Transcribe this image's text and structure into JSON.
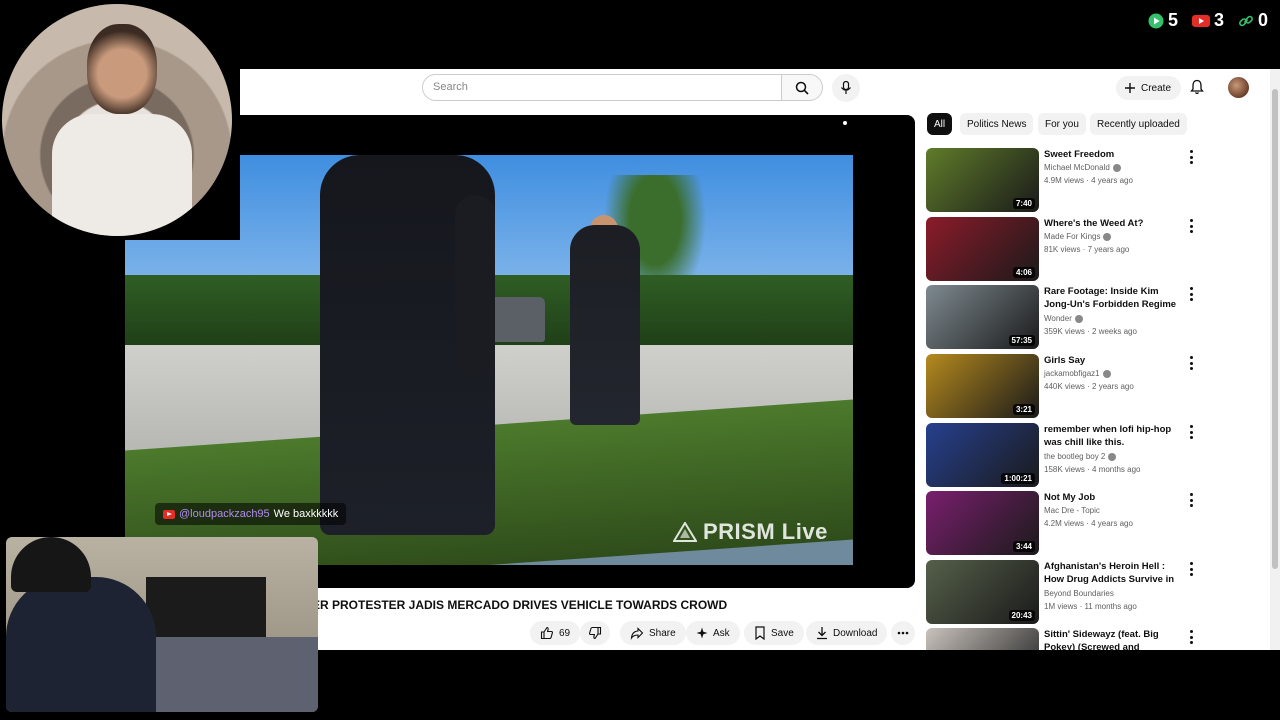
{
  "stream_stats": [
    {
      "icon": "play-triangle-icon",
      "value": "5",
      "color": "#35c16b"
    },
    {
      "icon": "youtube-icon",
      "value": "3",
      "color": "#e52d27"
    },
    {
      "icon": "link-icon",
      "value": "0",
      "color": "#35c16b"
    }
  ],
  "topbar": {
    "search_placeholder": "Search",
    "create_label": "Create"
  },
  "player": {
    "chat_user": "@loudpackzach95",
    "chat_message": "We baxkkkkk",
    "watermark": "PRISM Live"
  },
  "video": {
    "title": "ER PROTESTER JADIS MERCADO DRIVES VEHICLE TOWARDS CROWD",
    "likes": "69",
    "share_label": "Share",
    "ask_label": "Ask",
    "save_label": "Save",
    "download_label": "Download"
  },
  "chips": [
    "All",
    "Politics News",
    "For you",
    "Recently uploaded"
  ],
  "recommendations": [
    {
      "title": "Sweet Freedom",
      "channel": "Michael McDonald",
      "verified": true,
      "meta": "4.9M views · 4 years ago",
      "duration": "7:40",
      "music": true,
      "thumb_color": "#5f7c2a"
    },
    {
      "title": "Where's the Weed At?",
      "channel": "Made For Kings",
      "verified": true,
      "meta": "81K views · 7 years ago",
      "duration": "4:06",
      "music": true,
      "thumb_color": "#8c1b2a"
    },
    {
      "title": "Rare Footage: Inside Kim Jong-Un's Forbidden Regime",
      "channel": "Wonder",
      "verified": true,
      "meta": "359K views · 2 weeks ago",
      "duration": "57:35",
      "music": false,
      "thumb_color": "#7e8a90"
    },
    {
      "title": "Girls Say",
      "channel": "jackamobfigaz1",
      "verified": true,
      "meta": "440K views · 2 years ago",
      "duration": "3:21",
      "music": true,
      "thumb_color": "#b58a1e"
    },
    {
      "title": "remember when lofi hip-hop was chill like this.",
      "channel": "the bootleg boy 2",
      "verified": true,
      "meta": "158K views · 4 months ago",
      "duration": "1:00:21",
      "music": true,
      "thumb_color": "#26408f"
    },
    {
      "title": "Not My Job",
      "channel": "Mac Dre - Topic",
      "verified": false,
      "meta": "4.2M views · 4 years ago",
      "duration": "3:44",
      "music": true,
      "thumb_color": "#7a1f6e"
    },
    {
      "title": "Afghanistan's Heroin Hell : How Drug Addicts Survive in ...",
      "channel": "Beyond Boundaries",
      "verified": false,
      "meta": "1M views · 11 months ago",
      "duration": "20:43",
      "music": false,
      "thumb_color": "#55604a"
    },
    {
      "title": "Sittin' Sidewayz (feat. Big Pokey) (Screwed and Chopped)",
      "channel": "",
      "verified": false,
      "meta": "",
      "duration": "",
      "music": false,
      "thumb_color": "#c9c3bd"
    }
  ]
}
